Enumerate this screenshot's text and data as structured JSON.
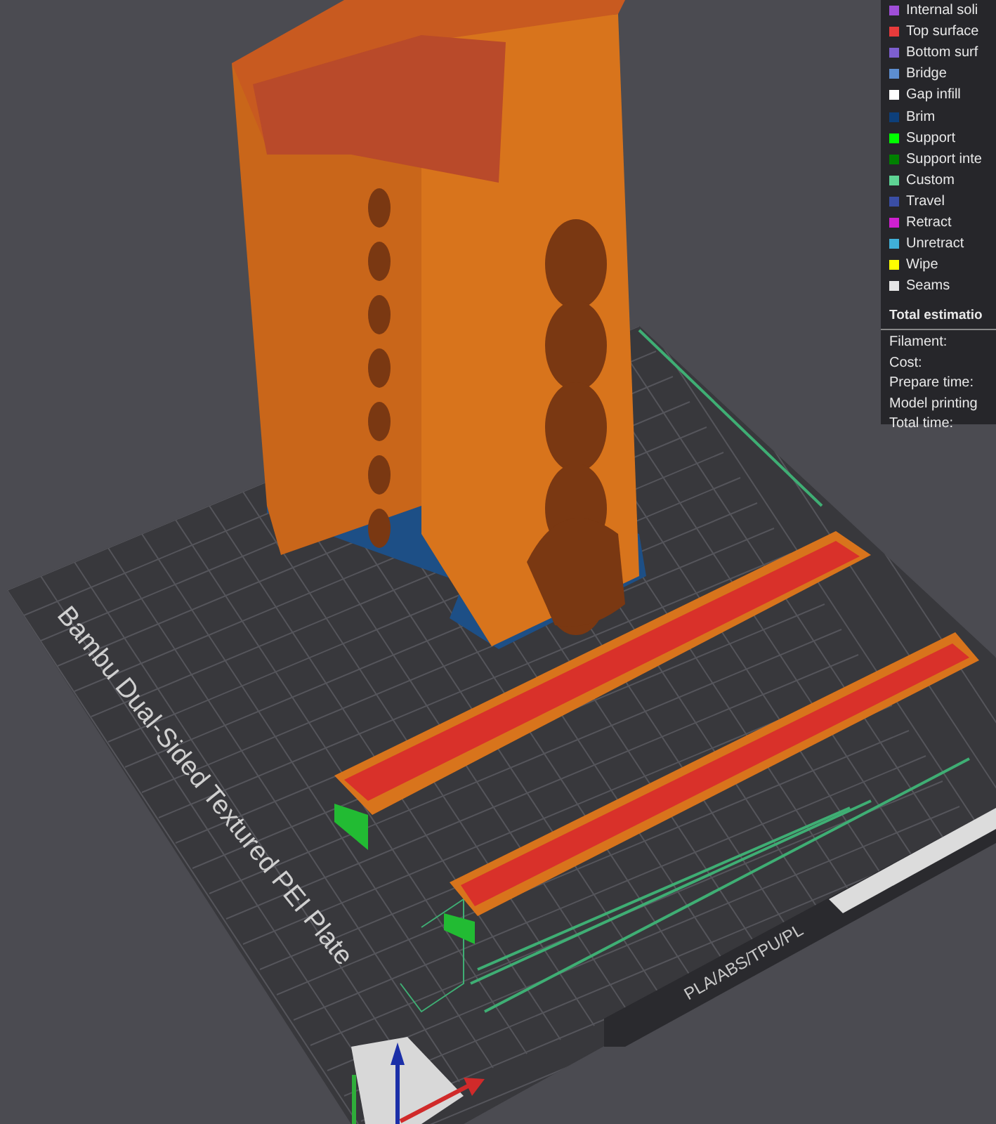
{
  "legend": {
    "items": [
      {
        "label": "Internal soli",
        "color": "#a04ed8"
      },
      {
        "label": "Top surface",
        "color": "#e83b3b"
      },
      {
        "label": "Bottom surf",
        "color": "#7d5fd0"
      },
      {
        "label": "Bridge",
        "color": "#5d8ed0"
      },
      {
        "label": "Gap infill",
        "color": "#ffffff"
      },
      {
        "label": "Brim",
        "color": "#0d3f7a"
      },
      {
        "label": "Support",
        "color": "#00ff00"
      },
      {
        "label": "Support inte",
        "color": "#008000"
      },
      {
        "label": "Custom",
        "color": "#5ed394"
      },
      {
        "label": "Travel",
        "color": "#3a4ea5"
      },
      {
        "label": "Retract",
        "color": "#d020d0"
      },
      {
        "label": "Unretract",
        "color": "#40b0d8"
      },
      {
        "label": "Wipe",
        "color": "#ffff00"
      },
      {
        "label": "Seams",
        "color": "#e6e6e6"
      }
    ]
  },
  "estimation": {
    "title": "Total estimatio",
    "rows": [
      "Filament:",
      "Cost:",
      "Prepare time:",
      "Model printing",
      "Total time:"
    ]
  },
  "plate": {
    "name": "Bambu Dual-Sided Textured PEI Plate",
    "material_label": "PLA/ABS/TPU/PL"
  }
}
